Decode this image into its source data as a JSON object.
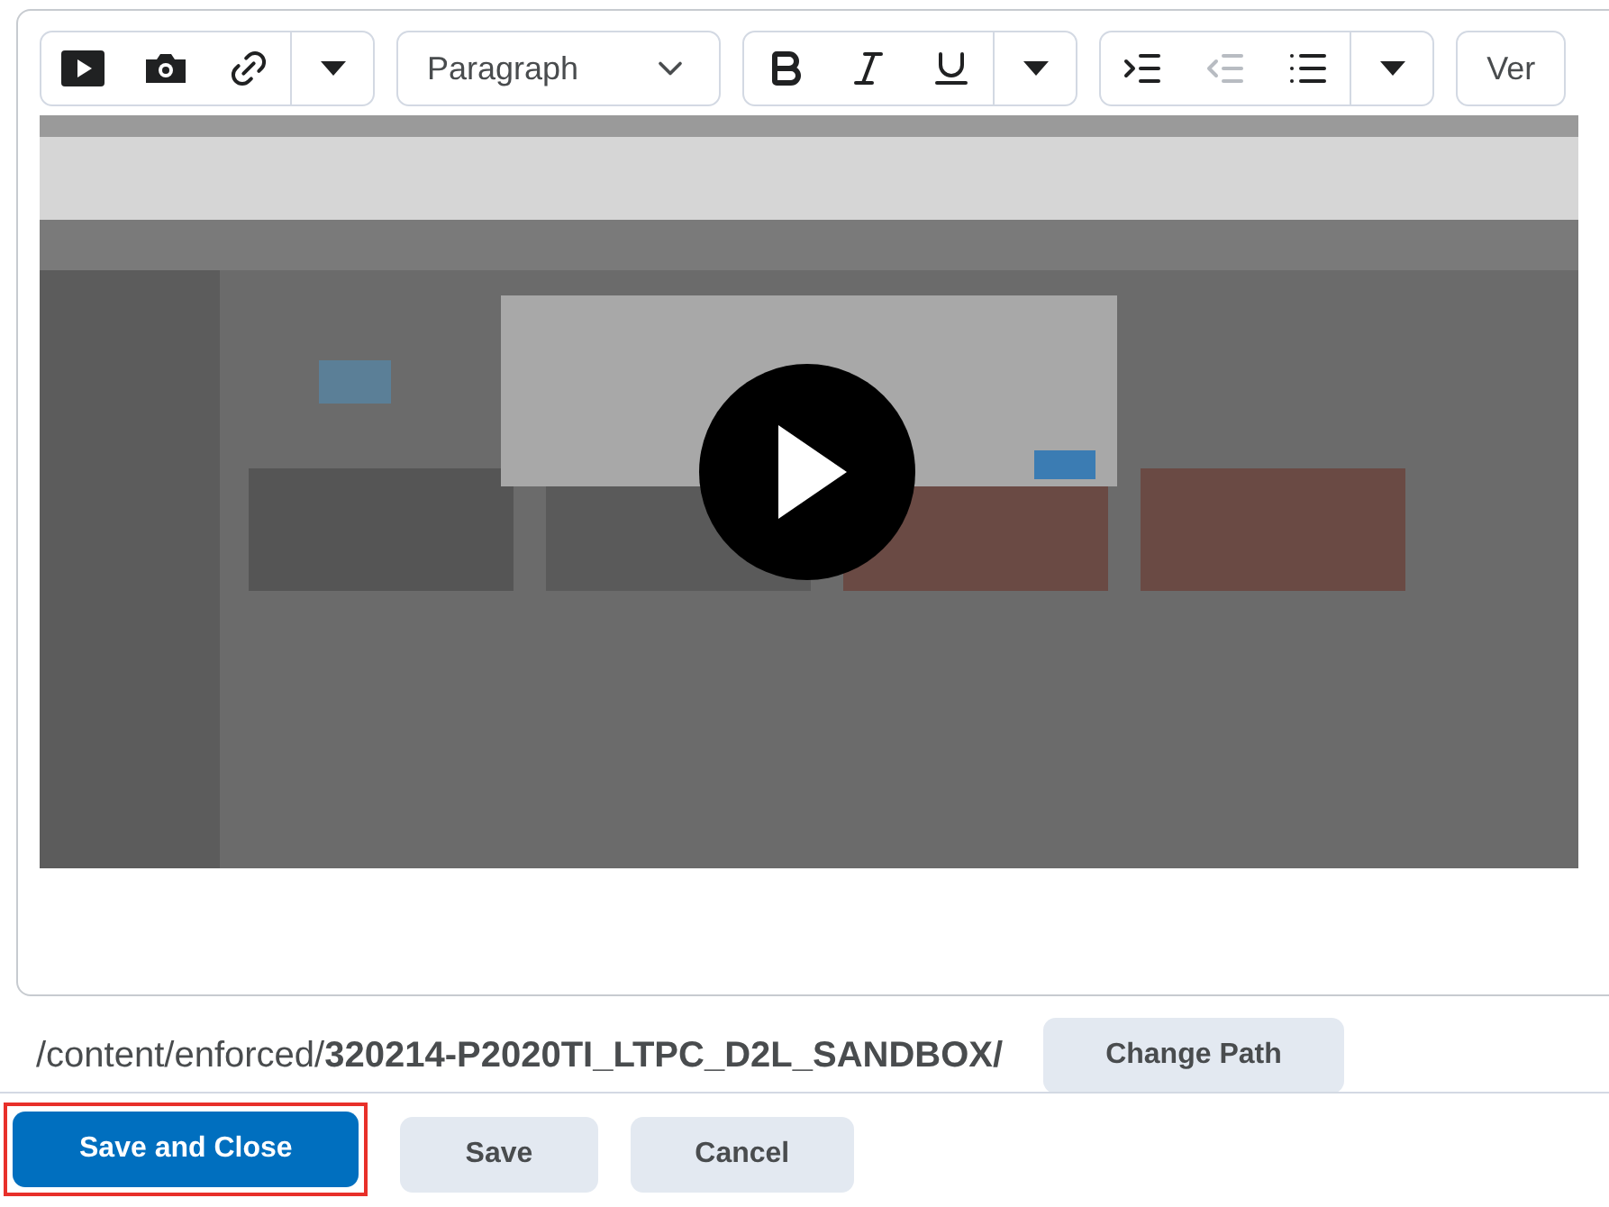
{
  "toolbar": {
    "groups": [
      {
        "kind": "buttons",
        "buttons": [
          {
            "kind": "video",
            "disabled": false
          },
          {
            "kind": "camera",
            "disabled": false
          },
          {
            "kind": "link",
            "disabled": false
          },
          {
            "kind": "caret",
            "disabled": false
          }
        ]
      },
      {
        "kind": "select",
        "value": "Paragraph"
      },
      {
        "kind": "buttons",
        "buttons": [
          {
            "kind": "bold",
            "disabled": false
          },
          {
            "kind": "italic",
            "disabled": false
          },
          {
            "kind": "underline",
            "disabled": false
          },
          {
            "kind": "caret",
            "disabled": false
          }
        ]
      },
      {
        "kind": "buttons",
        "buttons": [
          {
            "kind": "indent",
            "disabled": false
          },
          {
            "kind": "outdent",
            "disabled": true
          },
          {
            "kind": "list",
            "disabled": false
          },
          {
            "kind": "caret",
            "disabled": false
          }
        ]
      },
      {
        "kind": "select",
        "value": "Ver"
      }
    ]
  },
  "path": {
    "text": "/content/enforced/**320214-P2020TI_LTPC_D2L_SANDBOX/**",
    "button": "Change Path"
  },
  "actions": [
    {
      "label": "Save and Close",
      "primary": true,
      "highlighted": true
    },
    {
      "label": "Save",
      "primary": false,
      "highlighted": false
    },
    {
      "label": "Cancel",
      "primary": false,
      "highlighted": false
    }
  ]
}
